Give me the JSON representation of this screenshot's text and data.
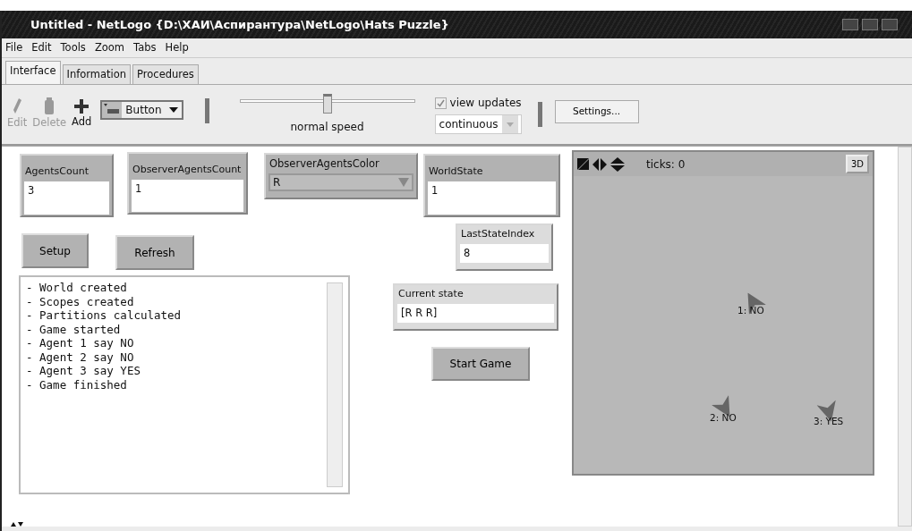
{
  "window": {
    "title": "Untitled - NetLogo {D:\\ХАИ\\Аспирантура\\NetLogo\\Hats Puzzle}"
  },
  "menu": [
    "File",
    "Edit",
    "Tools",
    "Zoom",
    "Tabs",
    "Help"
  ],
  "tabs": [
    {
      "label": "Interface",
      "selected": true
    },
    {
      "label": "Information",
      "selected": false
    },
    {
      "label": "Procedures",
      "selected": false
    }
  ],
  "toolbar": {
    "tools": [
      {
        "kind": "edit",
        "label": "Edit",
        "disabled": true
      },
      {
        "kind": "delete",
        "label": "Delete",
        "disabled": true
      },
      {
        "kind": "add",
        "label": "Add",
        "disabled": false
      }
    ],
    "widget_type": "Button",
    "speed": {
      "level": 0.5,
      "label": "normal speed"
    },
    "view_updates": {
      "label": "view updates",
      "checked": true
    },
    "update_mode": "continuous",
    "settings": "Settings..."
  },
  "widgets": [
    {
      "kind": "input",
      "label": "AgentsCount",
      "value": "3"
    },
    {
      "kind": "input",
      "label": "ObserverAgentsCount",
      "value": "1"
    },
    {
      "kind": "chooser",
      "label": "ObserverAgentsColor",
      "value": "R"
    },
    {
      "kind": "input",
      "label": "WorldState",
      "value": "1"
    },
    {
      "kind": "button",
      "label": "Setup"
    },
    {
      "kind": "button",
      "label": "Refresh"
    },
    {
      "kind": "monitor",
      "label": "LastStateIndex",
      "value": "8"
    },
    {
      "kind": "output",
      "lines": [
        "- World created",
        "- Scopes created",
        "- Partitions calculated",
        "- Game started",
        "- Agent 1 say NO",
        "- Agent 2 say NO",
        "- Agent 3 say YES",
        "- Game finished"
      ]
    },
    {
      "kind": "monitor",
      "label": "Current state",
      "value": "[R R R]"
    },
    {
      "kind": "button",
      "label": "Start Game"
    },
    {
      "kind": "view",
      "ticks": "ticks: 0",
      "button_3d": "3D",
      "turtles": [
        {
          "label": "1: NO"
        },
        {
          "label": "2: NO"
        },
        {
          "label": "3: YES"
        }
      ]
    }
  ]
}
